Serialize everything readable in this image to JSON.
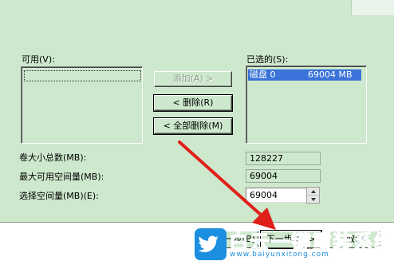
{
  "available": {
    "label": "可用(V):",
    "items": []
  },
  "selected": {
    "label": "已选的(S):",
    "items": [
      {
        "name": "磁盘 0",
        "size": "69004 MB"
      }
    ]
  },
  "actions": {
    "add": "添加(A) >",
    "remove": "< 删除(R)",
    "remove_all": "< 全部删除(M)"
  },
  "volume": {
    "total_label": "卷大小总数(MB):",
    "total_value": "128227",
    "max_label": "最大可用空间量(MB):",
    "max_value": "69004",
    "select_label": "选择空间量(MB)(E):",
    "select_value": "69004"
  },
  "nav": {
    "back": "< 上一步(B)",
    "next": "下一步(N) >",
    "cancel": "取消"
  },
  "watermark": {
    "title": "白云一键重装系统",
    "url": "www.baiyunxitong.com"
  },
  "colors": {
    "panel": "#cde8cd",
    "selection": "#3a73d9",
    "arrow": "#e0201a",
    "watermark": "#1d8fe0"
  }
}
